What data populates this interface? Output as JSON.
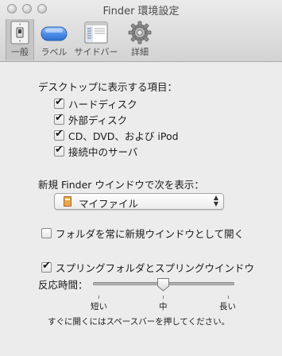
{
  "window": {
    "title": "Finder 環境設定"
  },
  "toolbar": {
    "items": [
      {
        "label": "一般",
        "icon": "light-switch-icon",
        "selected": true
      },
      {
        "label": "ラベル",
        "icon": "label-pill-icon",
        "selected": false
      },
      {
        "label": "サイドバー",
        "icon": "sidebar-window-icon",
        "selected": false
      },
      {
        "label": "詳細",
        "icon": "gear-icon",
        "selected": false
      }
    ]
  },
  "desktop_items": {
    "heading": "デスクトップに表示する項目：",
    "options": [
      {
        "label": "ハードディスク",
        "checked": true
      },
      {
        "label": "外部ディスク",
        "checked": true
      },
      {
        "label": "CD、DVD、および iPod",
        "checked": true
      },
      {
        "label": "接続中のサーバ",
        "checked": true
      }
    ]
  },
  "new_window": {
    "heading": "新規 Finder ウインドウで次を表示：",
    "selected": "マイファイル",
    "icon": "my-files-icon"
  },
  "folders_new_window": {
    "label": "フォルダを常に新規ウインドウとして開く",
    "checked": false
  },
  "spring_loaded": {
    "label": "スプリングフォルダとスプリングウインドウ",
    "checked": true,
    "delay_label": "反応時間：",
    "short_label": "短い",
    "medium_label": "中",
    "long_label": "長い",
    "delay_value": 0.5,
    "hint": "すぐに開くにはスペースバーを押してください。"
  },
  "colors": {
    "accent_blue": "#4f8fe8",
    "window_bg": "#ececec"
  }
}
